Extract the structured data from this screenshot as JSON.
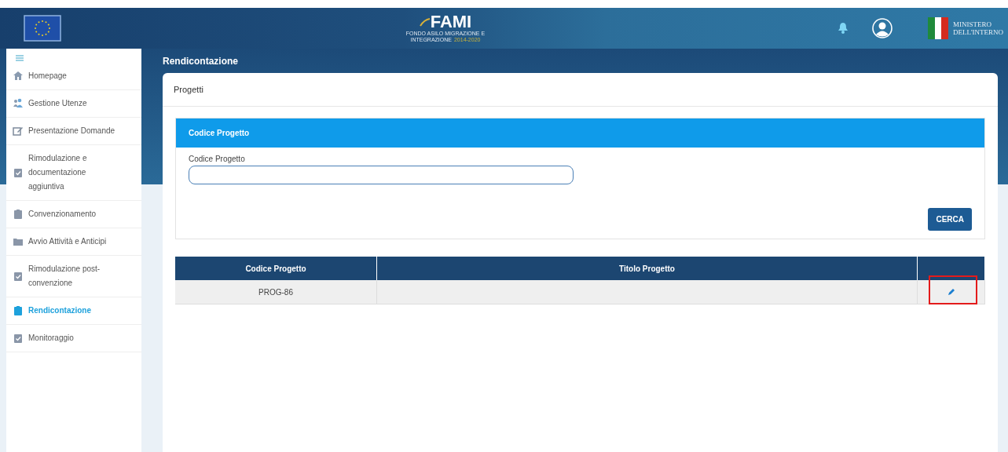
{
  "header": {
    "logo": {
      "title": "FAMI",
      "subtitle_1": "FONDO ASILO MIGRAZIONE E",
      "subtitle_2": "INTEGRAZIONE",
      "subtitle_3": "2014-2020"
    },
    "ministry": {
      "line_1": "MINISTERO",
      "line_2": "DELL'INTERNO"
    }
  },
  "sidebar": {
    "items": [
      {
        "label": "Homepage",
        "kind": "home",
        "selected": false
      },
      {
        "label": "Gestione Utenze",
        "kind": "users",
        "selected": false
      },
      {
        "label": "Presentazione Domande",
        "kind": "edit",
        "selected": false
      },
      {
        "label": "Rimodulazione e documentazione aggiuntiva",
        "kind": "check",
        "selected": false
      },
      {
        "label": "Convenzionamento",
        "kind": "clipboard",
        "selected": false
      },
      {
        "label": "Avvio Attività e Anticipi",
        "kind": "folder",
        "selected": false
      },
      {
        "label": "Rimodulazione post-convenzione",
        "kind": "check",
        "selected": false
      },
      {
        "label": "Rendicontazione",
        "kind": "clipboard",
        "selected": true
      },
      {
        "label": "Monitoraggio",
        "kind": "check",
        "selected": false
      }
    ]
  },
  "page_title": "Rendicontazione",
  "card_title": "Progetti",
  "search_panel": {
    "title": "Codice Progetto",
    "field_label": "Codice Progetto",
    "button": "CERCA"
  },
  "table": {
    "columns": [
      "Codice Progetto",
      "Titolo Progetto"
    ],
    "rows": [
      {
        "code": "PROG-86",
        "highlighted": true
      }
    ]
  }
}
